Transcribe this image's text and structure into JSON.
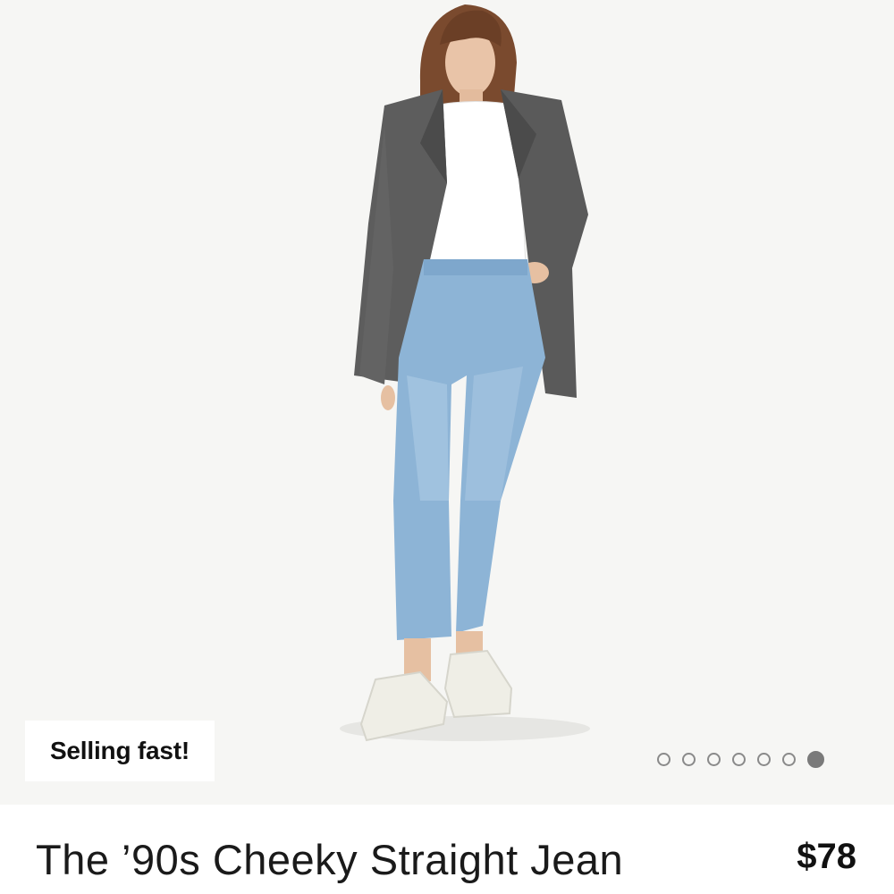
{
  "product": {
    "badge": "Selling fast!",
    "title": "The ’90s Cheeky Straight Jean",
    "price": "$78"
  },
  "carousel": {
    "total": 7,
    "active_index": 6
  },
  "colors": {
    "background": "#f6f6f4",
    "text": "#1a1a1a",
    "dot": "#7a7a7a"
  }
}
